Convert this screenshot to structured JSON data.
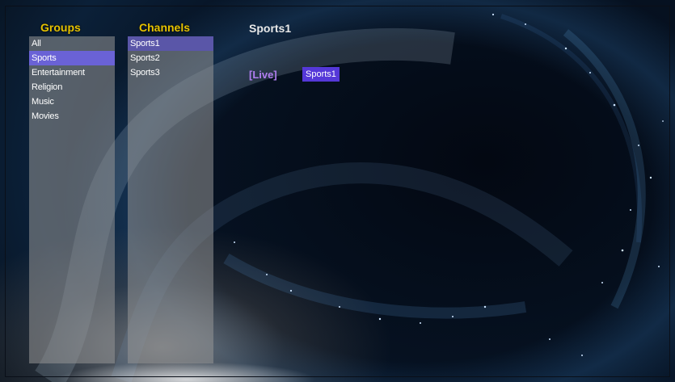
{
  "screen": {
    "title": "Sports1"
  },
  "groups": {
    "header": "Groups",
    "items": [
      "All",
      "Sports",
      "Entertainment",
      "Religion",
      "Music",
      "Movies"
    ],
    "selected": "Sports"
  },
  "channels": {
    "header": "Channels",
    "items": [
      "Sports1",
      "Sports2",
      "Sports3"
    ],
    "selected": "Sports1"
  },
  "epg": {
    "live_label": "[Live]",
    "live_program": "Sports1"
  },
  "colors": {
    "header_accent": "#e6c200",
    "selection": "#6a62d6",
    "live_accent": "#b07ef0",
    "program_highlight": "#5538d8"
  }
}
